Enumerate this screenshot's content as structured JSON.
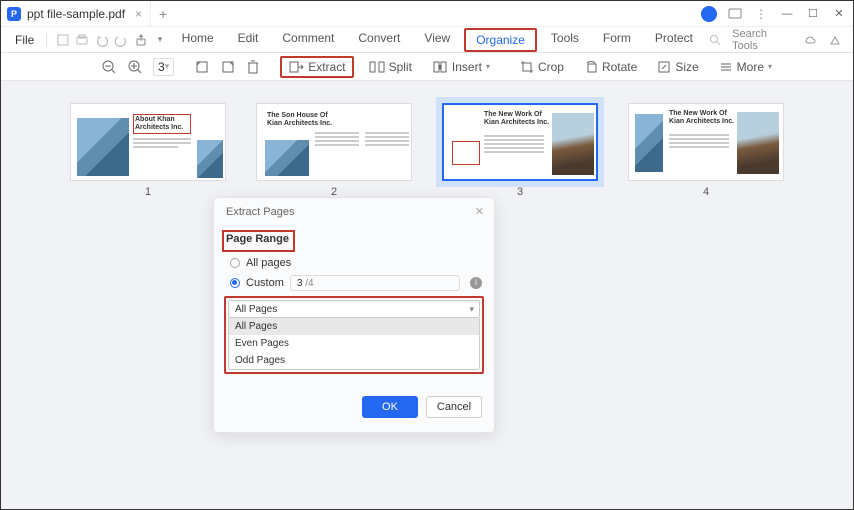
{
  "tab": {
    "title": "ppt file-sample.pdf"
  },
  "menu": {
    "file": "File",
    "items": [
      "Home",
      "Edit",
      "Comment",
      "Convert",
      "View",
      "Organize",
      "Tools",
      "Form",
      "Protect"
    ],
    "active": "Organize",
    "search": "Search Tools"
  },
  "toolbar": {
    "page_value": "3",
    "extract": "Extract",
    "split": "Split",
    "insert": "Insert",
    "crop": "Crop",
    "rotate": "Rotate",
    "size": "Size",
    "more": "More"
  },
  "thumbnails": {
    "p1": {
      "num": "1",
      "heading": "About Khan Architects Inc."
    },
    "p2": {
      "num": "2",
      "heading": "The Son House Of Kian Architects Inc."
    },
    "p3": {
      "num": "3",
      "heading": "The New Work Of Kian Architects Inc."
    },
    "p4": {
      "num": "4",
      "heading": "The New Work Of Kian Architects Inc."
    }
  },
  "dialog": {
    "title": "Extract Pages",
    "section": "Page Range",
    "opt_all": "All pages",
    "opt_custom": "Custom",
    "range_value": "3",
    "range_hint": "/4",
    "select_value": "All Pages",
    "options": [
      "All Pages",
      "Even Pages",
      "Odd Pages"
    ],
    "ok": "OK",
    "cancel": "Cancel"
  }
}
